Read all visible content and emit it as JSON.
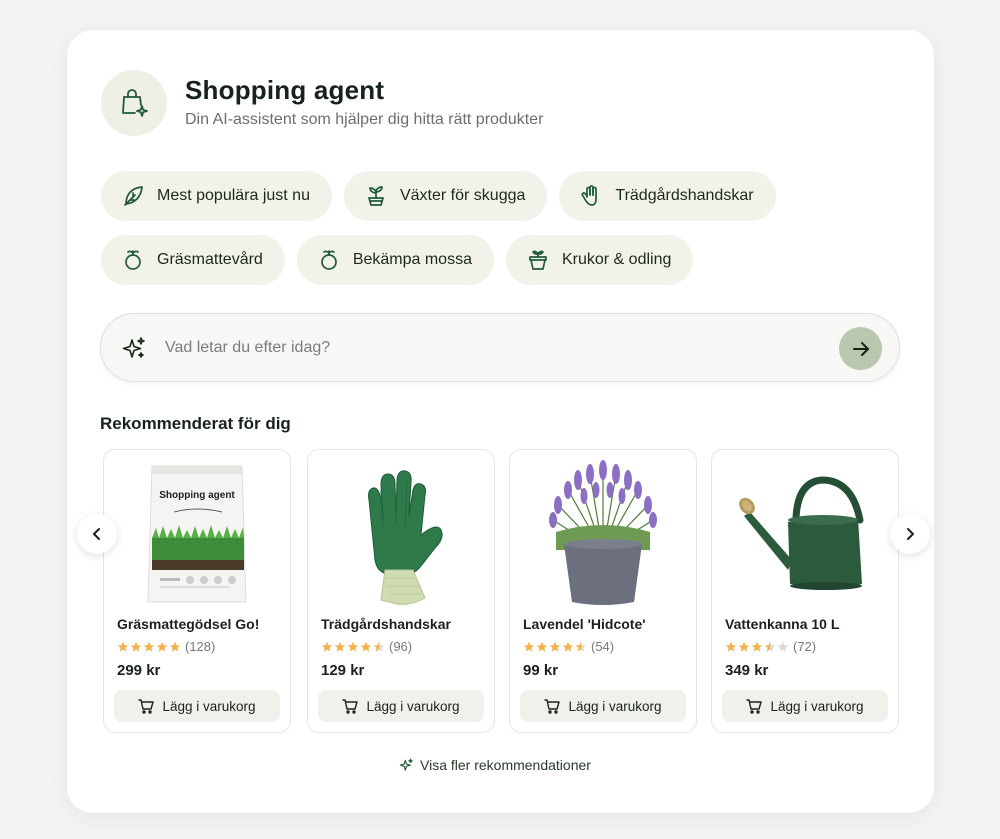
{
  "header": {
    "title": "Shopping agent",
    "subtitle": "Din AI-assistent som hjälper dig hitta rätt produkter",
    "icon": "shopping-bag-sparkle-icon"
  },
  "chips": [
    {
      "label": "Mest populära just nu",
      "icon": "leaf-icon"
    },
    {
      "label": "Växter för skugga",
      "icon": "plant-pot-icon"
    },
    {
      "label": "Trädgårdshandskar",
      "icon": "glove-icon"
    },
    {
      "label": "Gräsmattevård",
      "icon": "sprout-icon"
    },
    {
      "label": "Bekämpa mossa",
      "icon": "sprout-icon"
    },
    {
      "label": "Krukor & odling",
      "icon": "planter-icon"
    }
  ],
  "search": {
    "placeholder": "Vad letar du efter idag?",
    "submit_icon": "arrow-right-icon"
  },
  "recommended": {
    "title": "Rekommenderat för dig",
    "products": [
      {
        "name": "Gräsmattegödsel Go!",
        "rating": 5,
        "reviews": "(128)",
        "price": "299 kr",
        "cta": "Lägg i varukorg",
        "bag_brand": "Shopping agent"
      },
      {
        "name": "Trädgårdshandskar",
        "rating": 4.5,
        "reviews": "(96)",
        "price": "129 kr",
        "cta": "Lägg i varukorg"
      },
      {
        "name": "Lavendel 'Hidcote'",
        "rating": 4.5,
        "reviews": "(54)",
        "price": "99 kr",
        "cta": "Lägg i varukorg"
      },
      {
        "name": "Vattenkanna 10 L",
        "rating": 3.5,
        "reviews": "(72)",
        "price": "349 kr",
        "cta": "Lägg i varukorg"
      }
    ]
  },
  "more_link": "Visa fler rekommendationer",
  "colors": {
    "accent_green": "#1f5a3a",
    "chip_bg": "#f2f2ea",
    "star": "#f0b24a",
    "submit_bg": "#b8c7ad"
  }
}
